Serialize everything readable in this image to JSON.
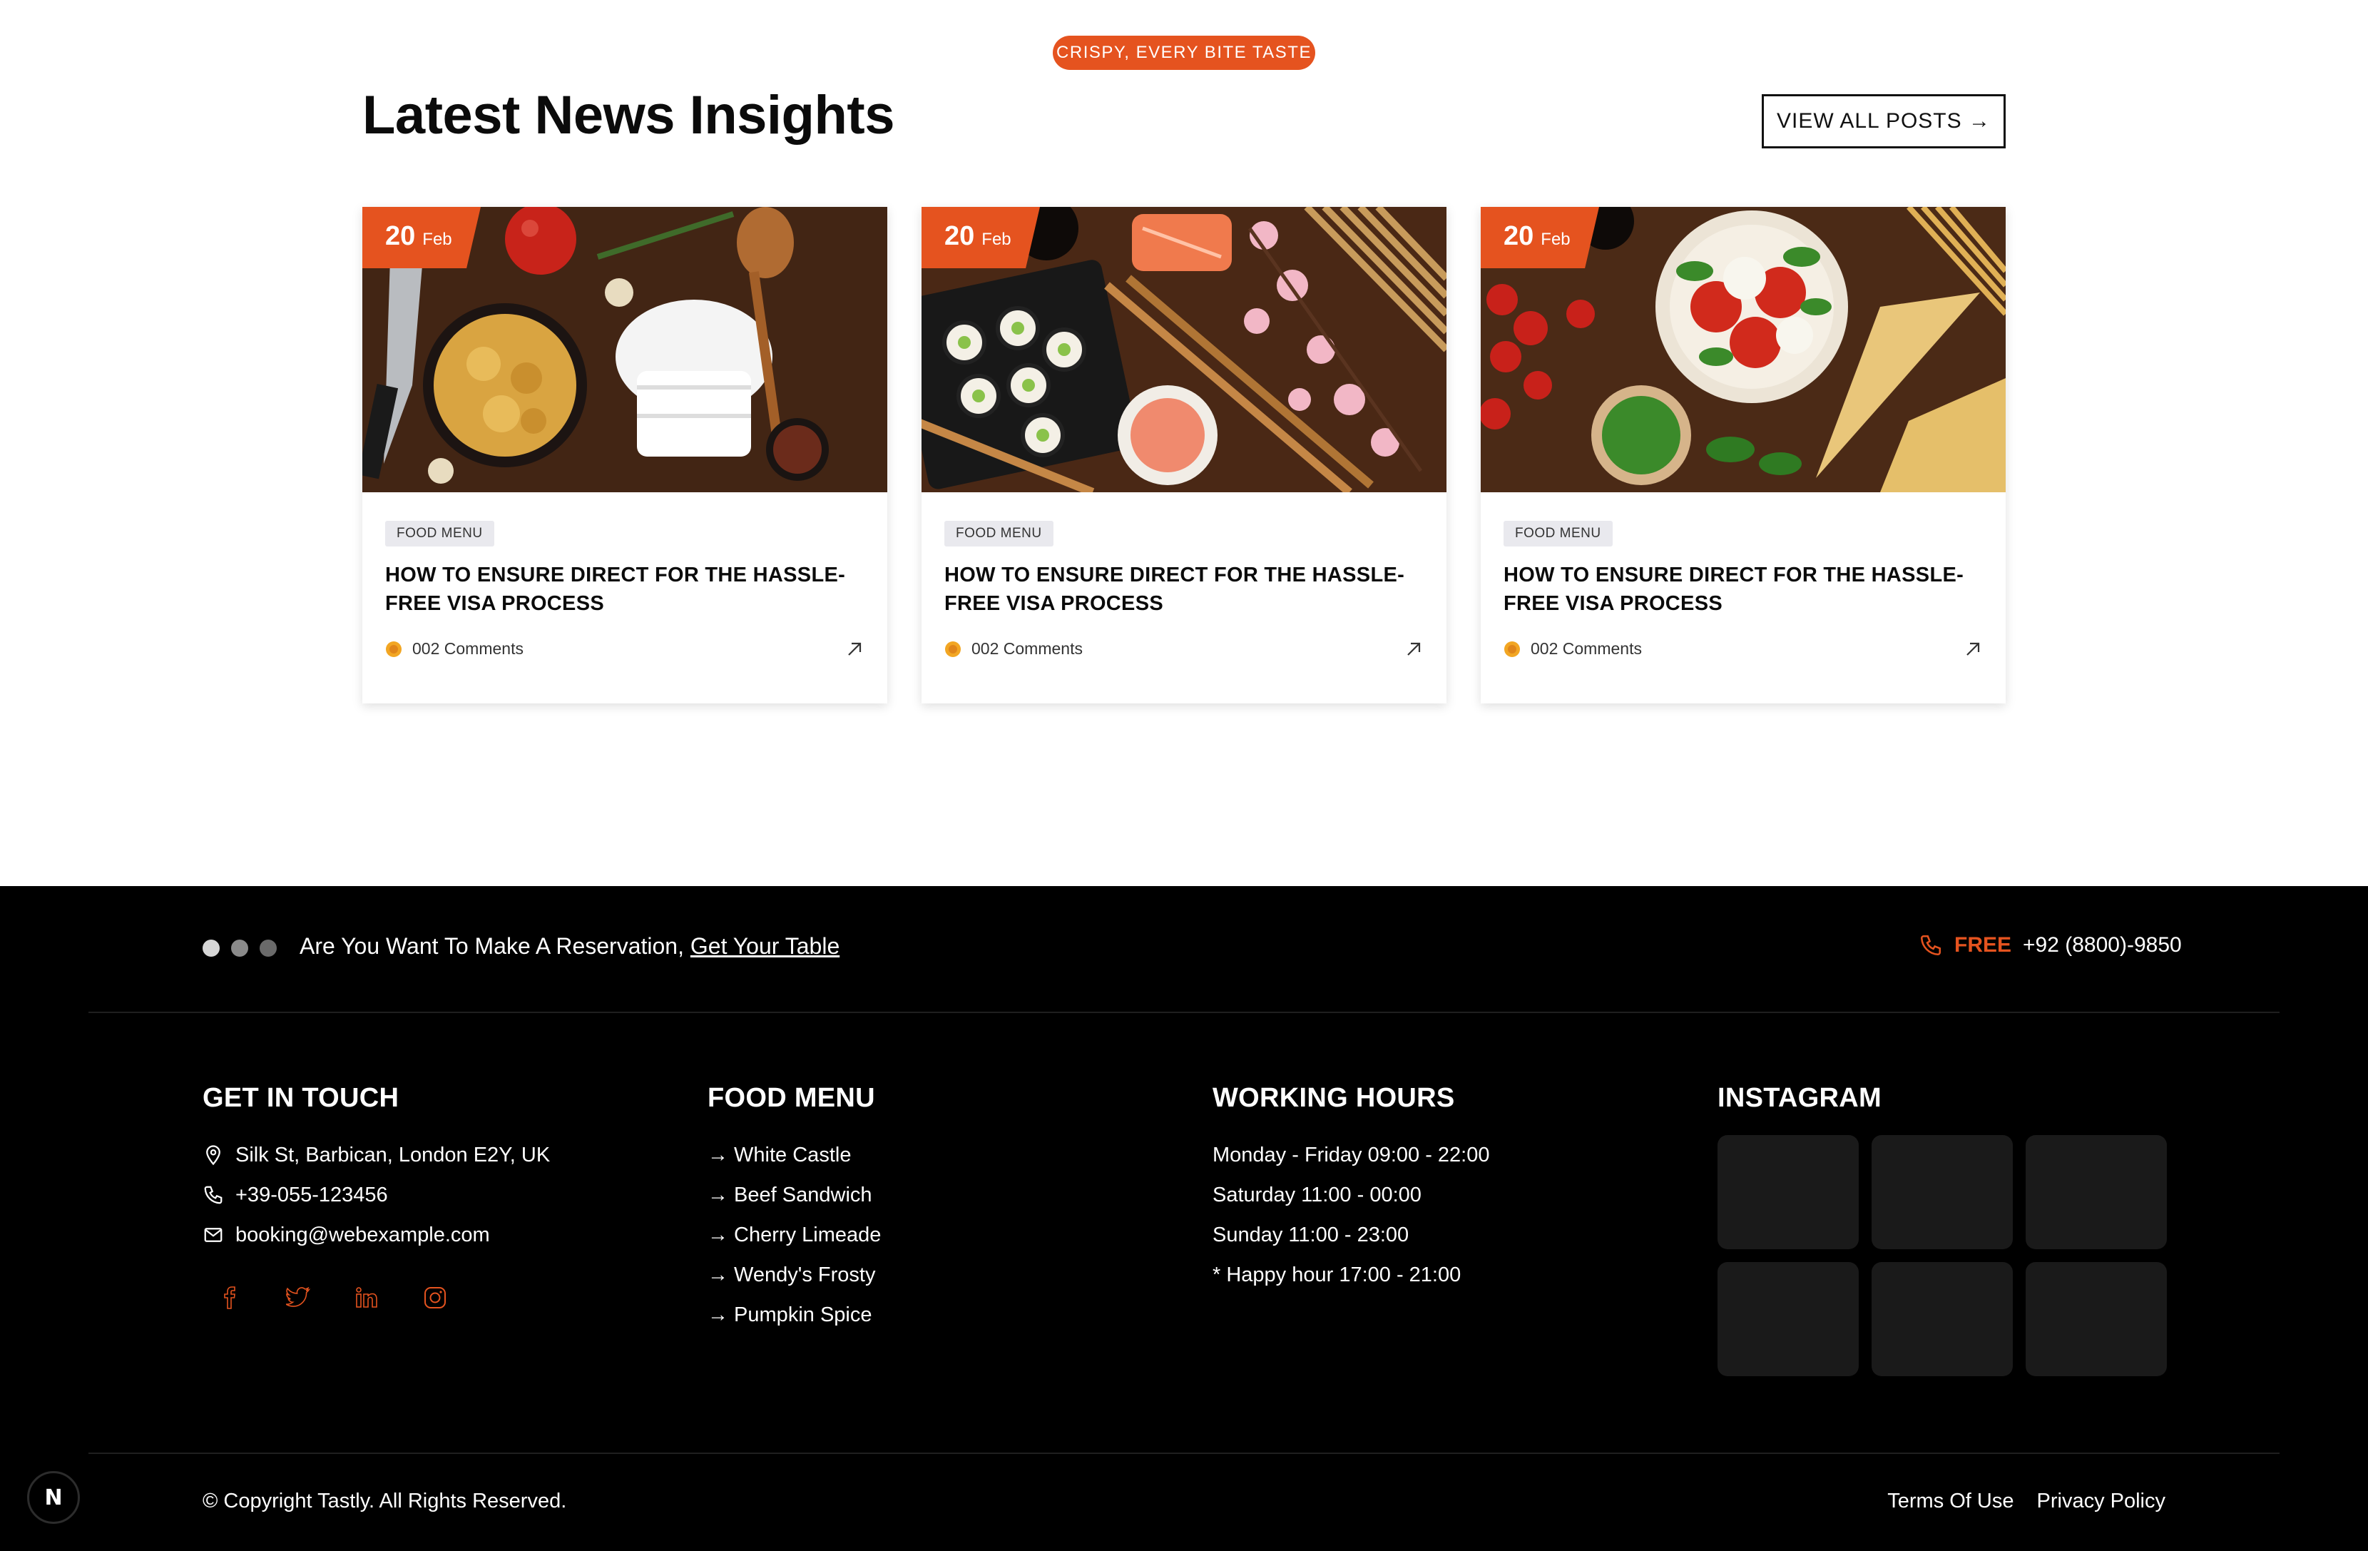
{
  "news": {
    "pill": "CRISPY, EVERY BITE TASTE",
    "title": "Latest News Insights",
    "view_all": "VIEW ALL POSTS →",
    "cards": [
      {
        "day": "20",
        "month": "Feb",
        "tag": "FOOD MENU",
        "title": "HOW TO ENSURE DIRECT FOR THE HASSLE-FREE VISA PROCESS",
        "comments": "002 Comments",
        "image": "pasta-chef-hat-photo"
      },
      {
        "day": "20",
        "month": "Feb",
        "tag": "FOOD MENU",
        "title": "HOW TO ENSURE DIRECT FOR THE HASSLE-FREE VISA PROCESS",
        "comments": "002 Comments",
        "image": "sushi-chopsticks-photo"
      },
      {
        "day": "20",
        "month": "Feb",
        "tag": "FOOD MENU",
        "title": "HOW TO ENSURE DIRECT FOR THE HASSLE-FREE VISA PROCESS",
        "comments": "002 Comments",
        "image": "caprese-cheese-photo"
      }
    ]
  },
  "footer": {
    "reservation_text": "Are You Want To Make A Reservation,",
    "reservation_link": "Get Your Table",
    "free_label": "FREE",
    "phone_top": "+92 (8800)-9850",
    "contact": {
      "heading": "GET IN TOUCH",
      "address": "Silk St, Barbican, London E2Y, UK",
      "phone": "+39-055-123456",
      "email": "booking@webexample.com"
    },
    "menu": {
      "heading": "FOOD MENU",
      "items": [
        "→ White Castle",
        "→ Beef Sandwich",
        "→ Cherry Limeade",
        "→ Wendy's Frosty",
        "→ Pumpkin Spice"
      ]
    },
    "hours": {
      "heading": "WORKING HOURS",
      "items": [
        "Monday - Friday 09:00 - 22:00",
        "Saturday 11:00 - 00:00",
        "Sunday 11:00 - 23:00",
        "* Happy hour 17:00 - 21:00"
      ]
    },
    "instagram": {
      "heading": "INSTAGRAM"
    },
    "copyright": "© Copyright Tastly. All Rights Reserved.",
    "terms": "Terms Of Use",
    "privacy": "Privacy Policy"
  },
  "badge": "N",
  "colors": {
    "accent": "#e5531f",
    "footer_bg": "#000000",
    "insta_tile": "#1a1a1a"
  }
}
